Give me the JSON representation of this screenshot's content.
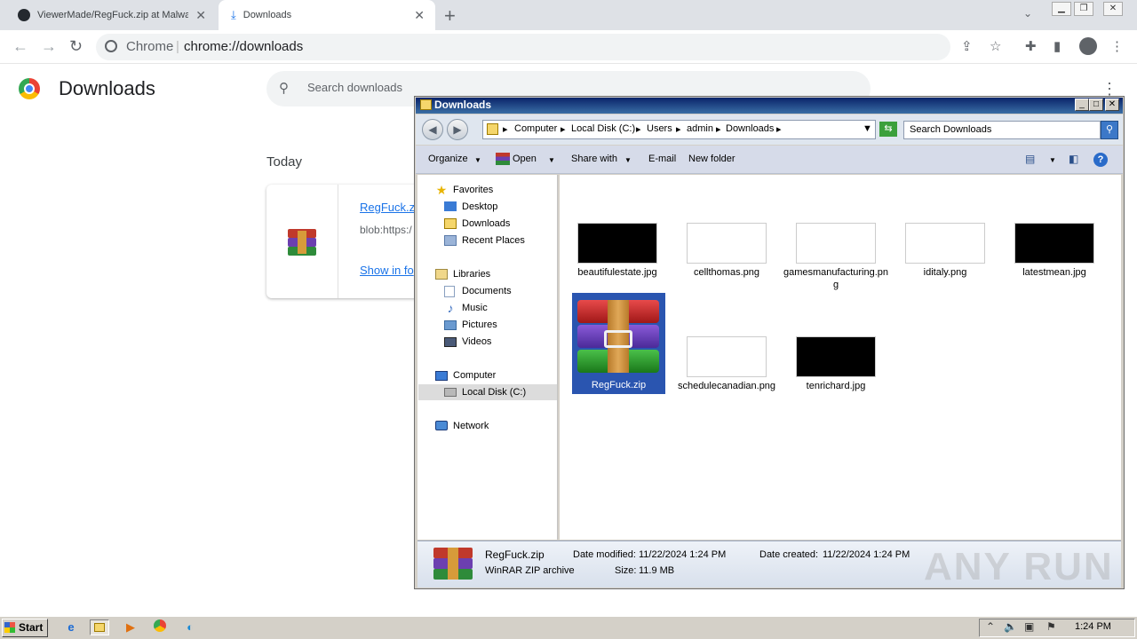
{
  "browser": {
    "tabs": [
      {
        "title": "ViewerMade/RegFuck.zip at Malware",
        "icon": "github-icon"
      },
      {
        "title": "Downloads",
        "icon": "download-icon"
      }
    ],
    "site_label": "Chrome",
    "url": "chrome://downloads"
  },
  "downloads_page": {
    "title": "Downloads",
    "search_placeholder": "Search downloads",
    "section": "Today",
    "item": {
      "name": "RegFuck.z",
      "url": "blob:https:/",
      "show_link": "Show in fo"
    }
  },
  "explorer": {
    "title": "Downloads",
    "breadcrumb": [
      "Computer",
      "Local Disk (C:)",
      "Users",
      "admin",
      "Downloads"
    ],
    "search_placeholder": "Search Downloads",
    "commands": {
      "organize": "Organize",
      "open": "Open",
      "share": "Share with",
      "email": "E-mail",
      "new_folder": "New folder"
    },
    "nav": {
      "favorites": "Favorites",
      "desktop": "Desktop",
      "downloads": "Downloads",
      "recent": "Recent Places",
      "libraries": "Libraries",
      "documents": "Documents",
      "music": "Music",
      "pictures": "Pictures",
      "videos": "Videos",
      "computer": "Computer",
      "local_disk": "Local Disk (C:)",
      "network": "Network"
    },
    "files": [
      {
        "name": "beautifulestate.jpg",
        "thumb": "dark"
      },
      {
        "name": "cellthomas.png",
        "thumb": "light"
      },
      {
        "name": "gamesmanufacturing.png",
        "thumb": "light"
      },
      {
        "name": "iditaly.png",
        "thumb": "light"
      },
      {
        "name": "latestmean.jpg",
        "thumb": "dark"
      },
      {
        "name": "RegFuck.zip",
        "thumb": "winrar",
        "selected": true
      },
      {
        "name": "schedulecanadian.png",
        "thumb": "light"
      },
      {
        "name": "tenrichard.jpg",
        "thumb": "dark"
      }
    ],
    "details": {
      "name": "RegFuck.zip",
      "type": "WinRAR ZIP archive",
      "modified_label": "Date modified:",
      "modified": "11/22/2024 1:24 PM",
      "size_label": "Size:",
      "size": "11.9 MB",
      "created_label": "Date created:",
      "created": "11/22/2024 1:24 PM"
    }
  },
  "watermark": "ANY RUN",
  "taskbar": {
    "start": "Start",
    "clock": "1:24 PM"
  }
}
